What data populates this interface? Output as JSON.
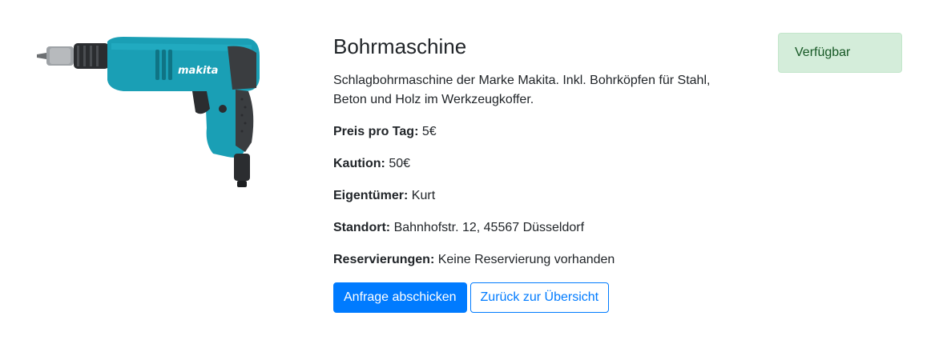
{
  "product": {
    "title": "Bohrmaschine",
    "description": "Schlagbohrmaschine der Marke Makita. Inkl. Bohrköpfen für Stahl, Beton und Holz im Werkzeugkoffer.",
    "image_brand_text": "makita",
    "image_icon": "power-drill-icon"
  },
  "info": [
    {
      "label": "Preis pro Tag:",
      "value": "5€"
    },
    {
      "label": "Kaution:",
      "value": "50€"
    },
    {
      "label": "Eigentümer:",
      "value": "Kurt"
    },
    {
      "label": "Standort:",
      "value": "Bahnhofstr. 12, 45567 Düsseldorf"
    },
    {
      "label": "Reservierungen:",
      "value": "Keine Reservierung vorhanden"
    }
  ],
  "actions": {
    "request_label": "Anfrage abschicken",
    "back_label": "Zurück zur Übersicht"
  },
  "status": {
    "label": "Verfügbar"
  },
  "colors": {
    "primary": "#007bff",
    "success_bg": "#d4edda",
    "success_text": "#155724",
    "drill_body": "#1a9fb5",
    "drill_grip": "#3a3d40"
  }
}
